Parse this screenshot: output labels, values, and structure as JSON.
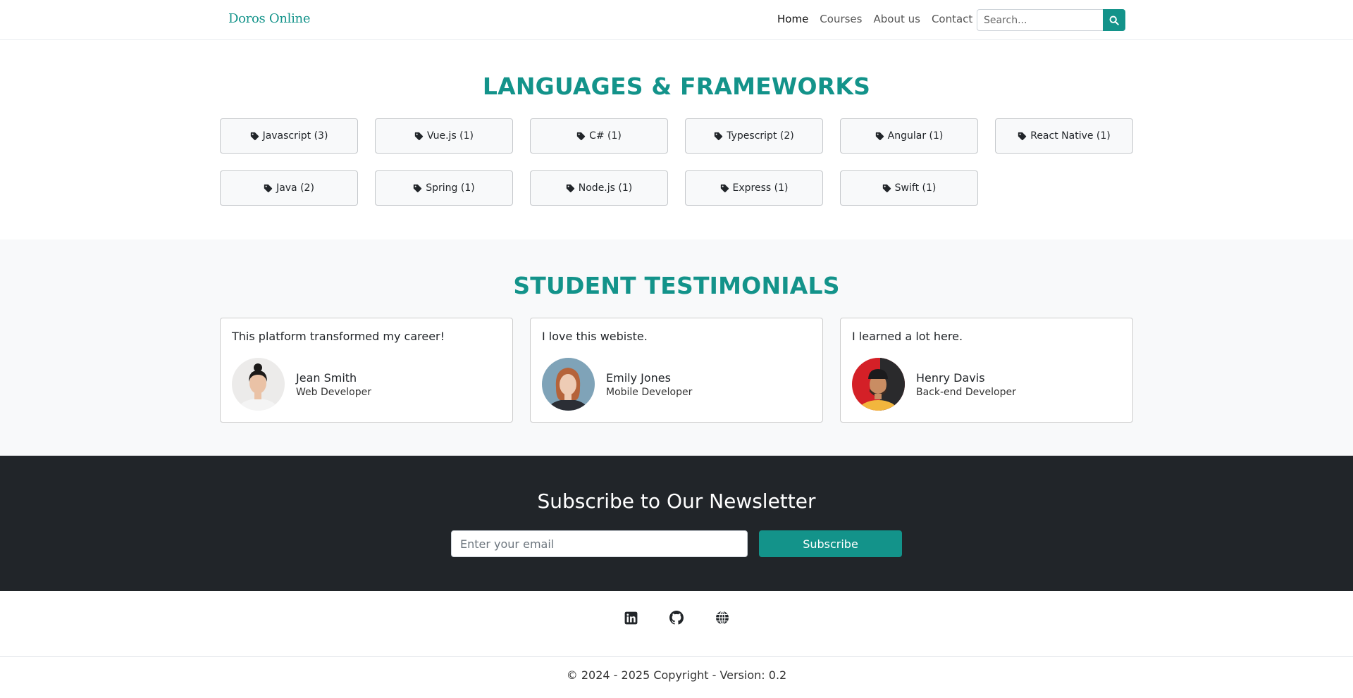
{
  "navbar": {
    "brand": "Doros Online",
    "links": [
      "Home",
      "Courses",
      "About us",
      "Contact us"
    ],
    "search_placeholder": "Search..."
  },
  "languages": {
    "title": "LANGUAGES & FRAMEWORKS",
    "tags": [
      "Javascript (3)",
      "Vue.js (1)",
      "C# (1)",
      "Typescript (2)",
      "Angular (1)",
      "React Native (1)",
      "Java (2)",
      "Spring (1)",
      "Node.js (1)",
      "Express (1)",
      "Swift (1)"
    ],
    "tag_icon": "tag-icon"
  },
  "testimonials": {
    "title": "STUDENT TESTIMONIALS",
    "items": [
      {
        "quote": "This platform transformed my career!",
        "name": "Jean Smith",
        "role": "Web Developer"
      },
      {
        "quote": "I love this webiste.",
        "name": "Emily Jones",
        "role": "Mobile Developer"
      },
      {
        "quote": "I learned a lot here.",
        "name": "Henry Davis",
        "role": "Back-end Developer"
      }
    ]
  },
  "newsletter": {
    "title": "Subscribe to Our Newsletter",
    "email_placeholder": "Enter your email",
    "button": "Subscribe"
  },
  "footer": {
    "icons": [
      "linkedin-icon",
      "github-icon",
      "globe-icon"
    ],
    "copyright": "© 2024 - 2025 Copyright - Version: 0.2"
  },
  "colors": {
    "accent": "#13938a",
    "dark": "#212529",
    "light_bg": "#f8f9fa"
  }
}
